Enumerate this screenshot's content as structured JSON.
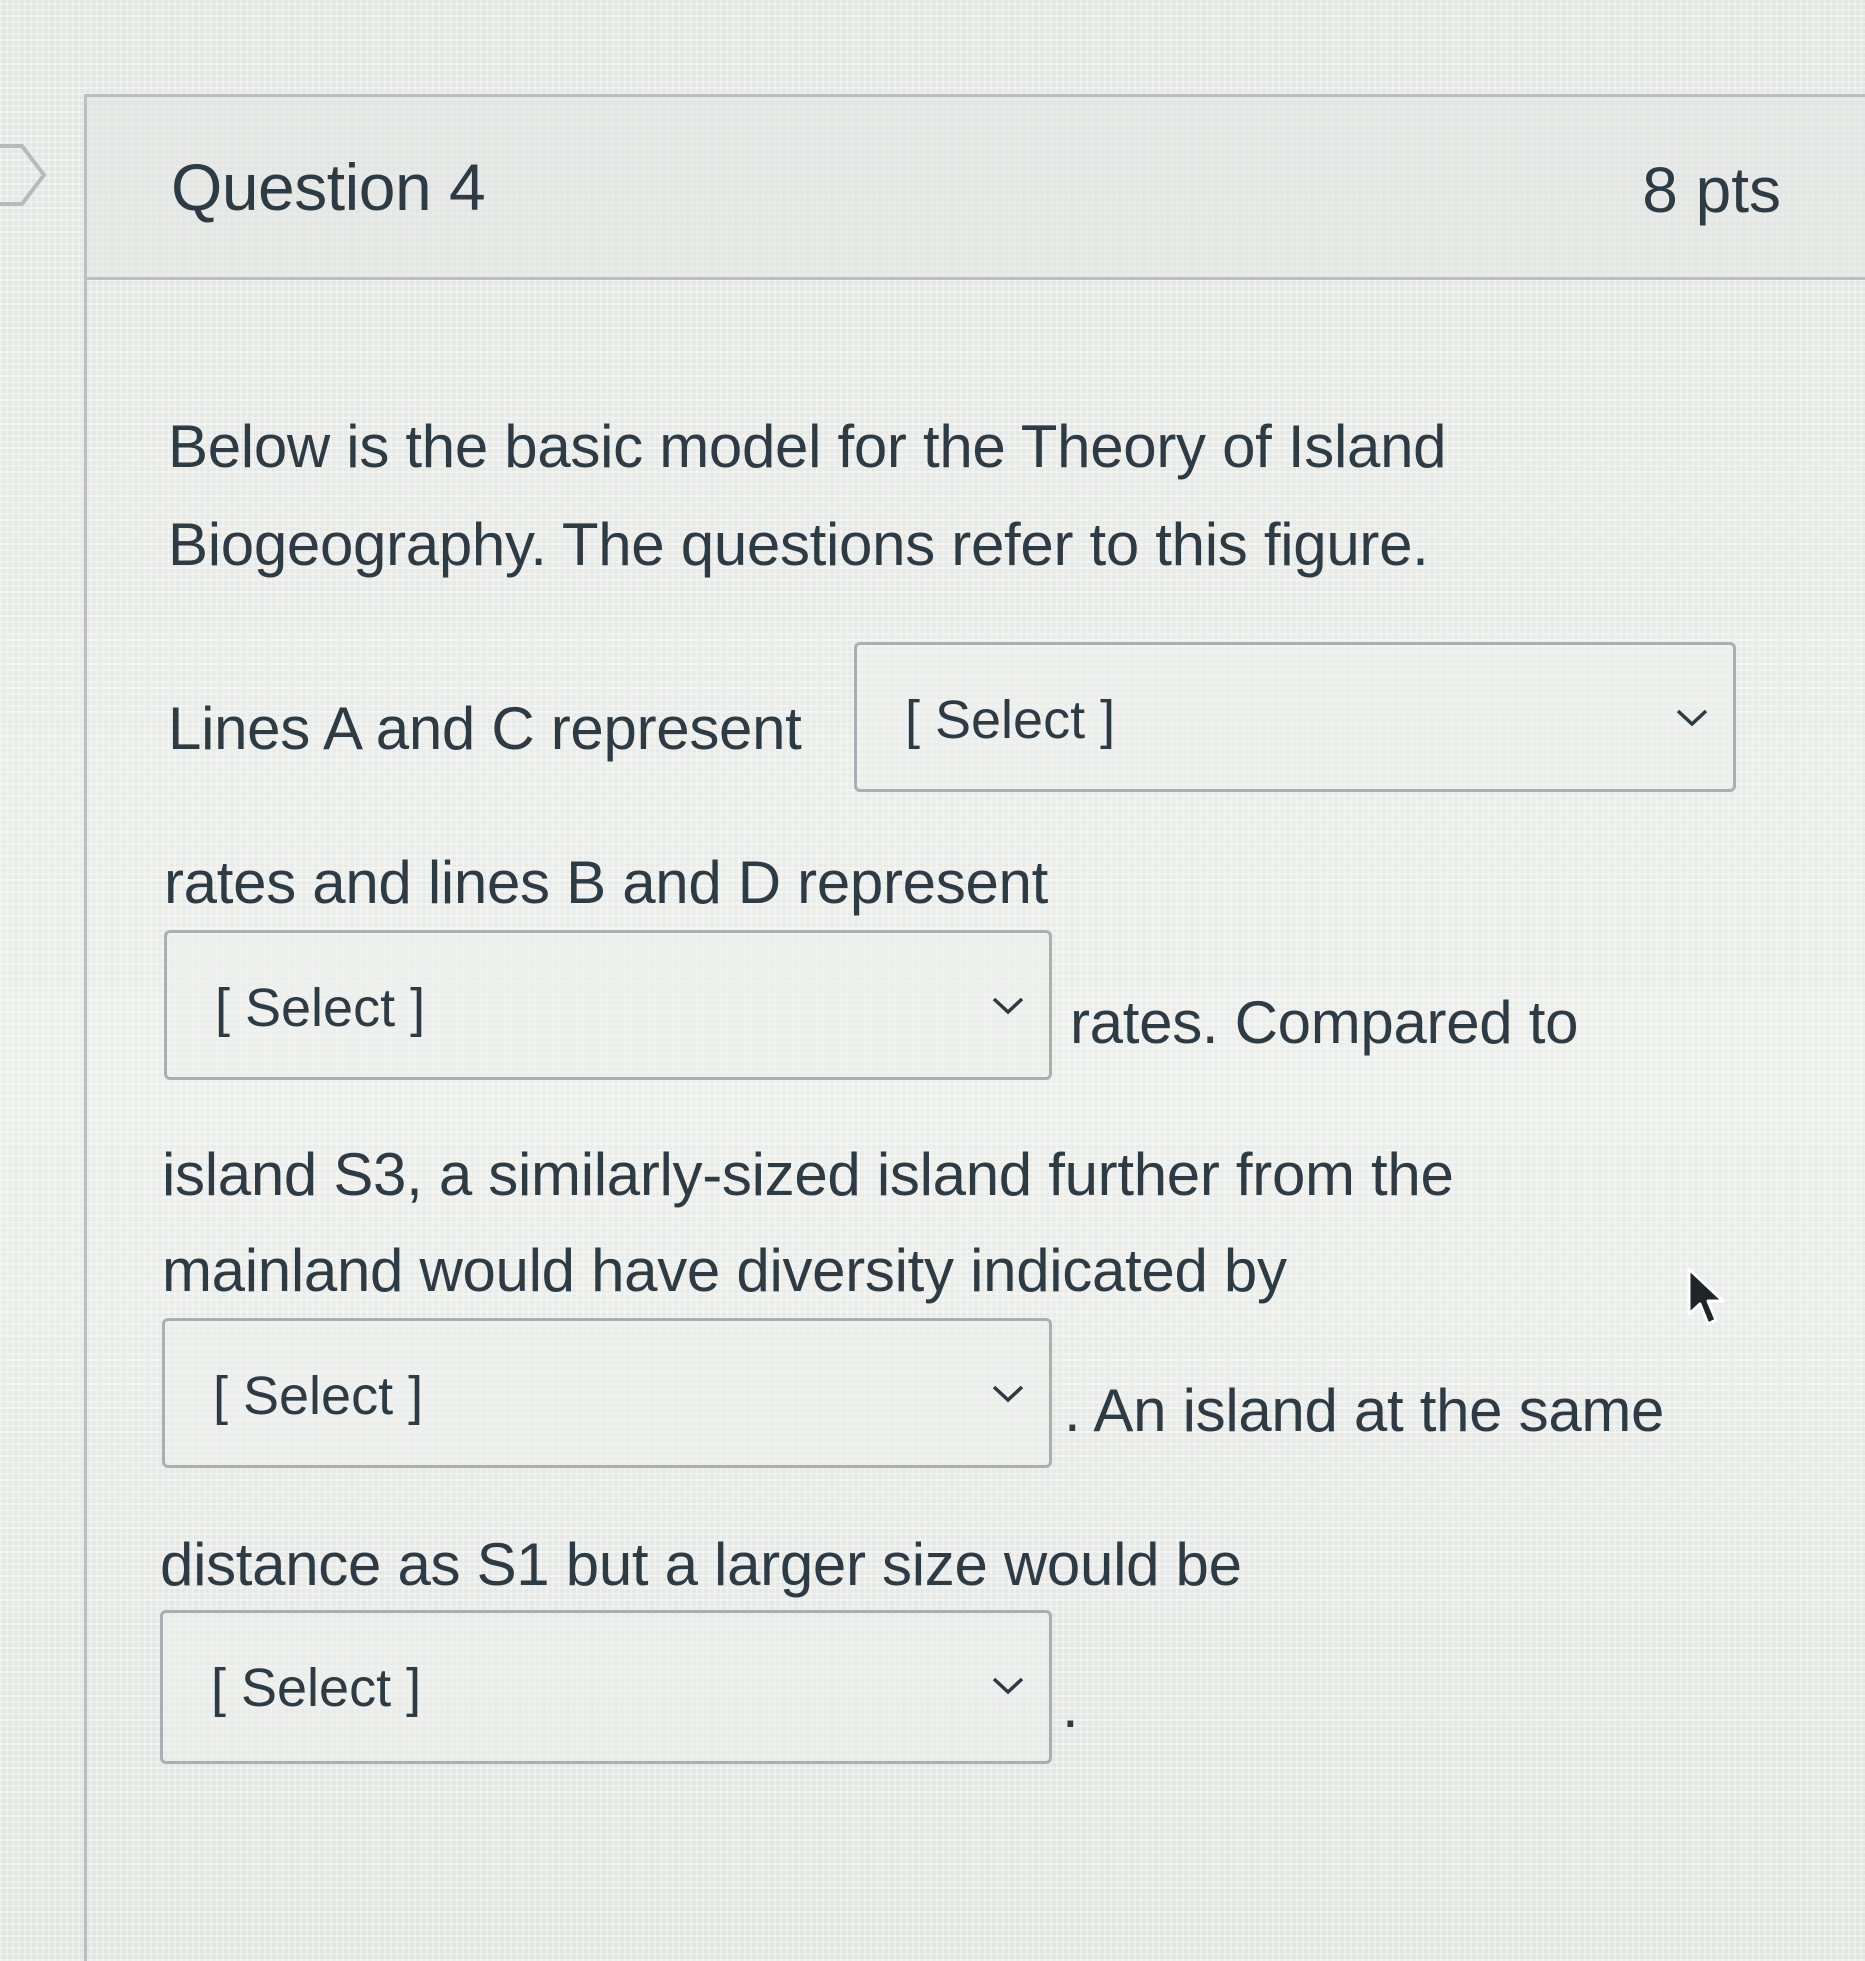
{
  "question": {
    "title": "Question 4",
    "points": "8 pts"
  },
  "body": {
    "line1": "Below is the basic model for the Theory of Island",
    "line2": "Biogeography. The questions refer to this figure.",
    "line3": "Lines A and C represent",
    "line4": "rates and lines B and D represent",
    "line5": "rates. Compared to",
    "line6": "island S3, a similarly-sized island further from the",
    "line7": "mainland would have diversity indicated by",
    "line8": ". An island at the same",
    "line9": "distance as S1 but a larger size would be",
    "line10": "."
  },
  "dropdowns": [
    {
      "value": "[ Select ]",
      "icon": "chevron-down-icon"
    },
    {
      "value": "[ Select ]",
      "icon": "chevron-down-icon"
    },
    {
      "value": "[ Select ]",
      "icon": "chevron-down-icon"
    },
    {
      "value": "[ Select ]",
      "icon": "chevron-down-icon"
    }
  ],
  "colors": {
    "text": "#2d3b45",
    "border": "#a9b0b4"
  }
}
